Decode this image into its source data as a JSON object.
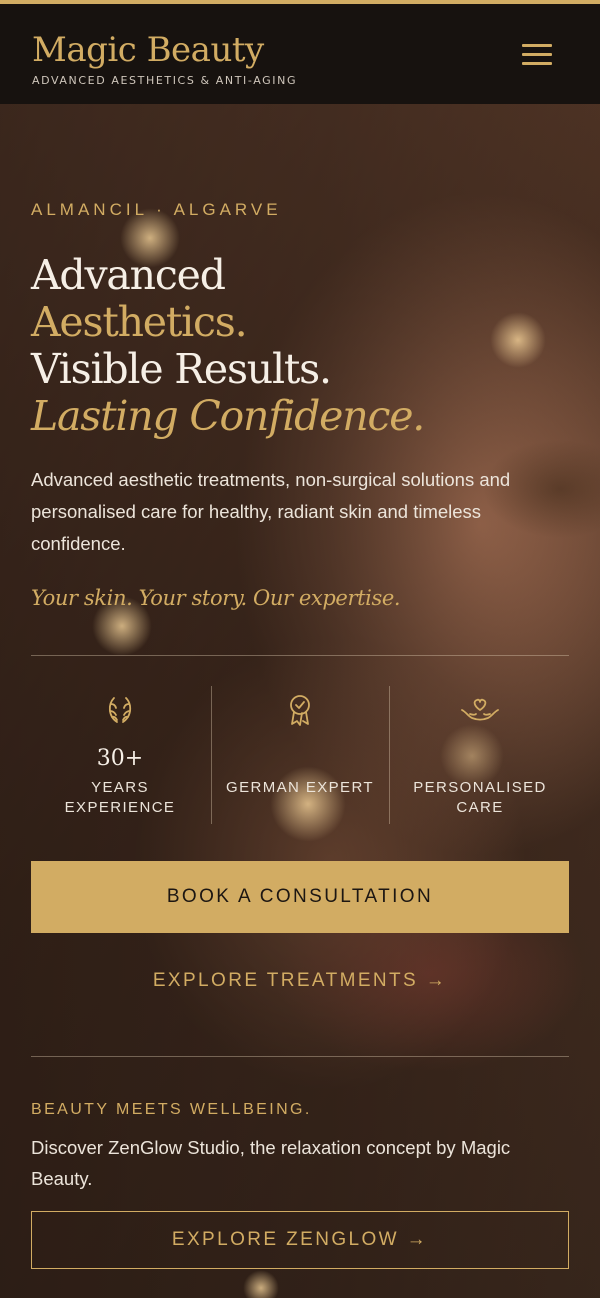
{
  "header": {
    "brand": "Magic Beauty",
    "tagline": "ADVANCED AESTHETICS & ANTI-AGING",
    "menu_icon": "hamburger-menu-icon"
  },
  "hero": {
    "eyebrow": "ALMANCIL · ALGARVE",
    "headline": {
      "line1": "Advanced",
      "line2": "Aesthetics.",
      "line3": "Visible Results.",
      "line4": "Lasting Confidence."
    },
    "lead": "Advanced aesthetic treatments, non-surgical solutions and personalised care for healthy, radiant skin and timeless confidence.",
    "motto": "Your skin. Your story. Our expertise."
  },
  "stats": [
    {
      "icon": "laurel-wreath-icon",
      "number": "30+",
      "label_line1": "YEARS",
      "label_line2": "EXPERIENCE"
    },
    {
      "icon": "award-ribbon-icon",
      "number": "",
      "label_line1": "GERMAN EXPERT",
      "label_line2": ""
    },
    {
      "icon": "heart-hands-icon",
      "number": "",
      "label_line1": "PERSONALISED",
      "label_line2": "CARE"
    }
  ],
  "cta": {
    "book_label": "BOOK A CONSULTATION",
    "treatments_label": "EXPLORE TREATMENTS →"
  },
  "wellbeing": {
    "title": "BEAUTY MEETS WELLBEING.",
    "text": "Discover ZenGlow Studio, the relaxation concept by Magic Beauty.",
    "button_label": "EXPLORE ZENGLOW →"
  },
  "colors": {
    "accent_gold": "#d2ac63",
    "header_bg": "#17120f",
    "text_light": "#f6efe6"
  }
}
